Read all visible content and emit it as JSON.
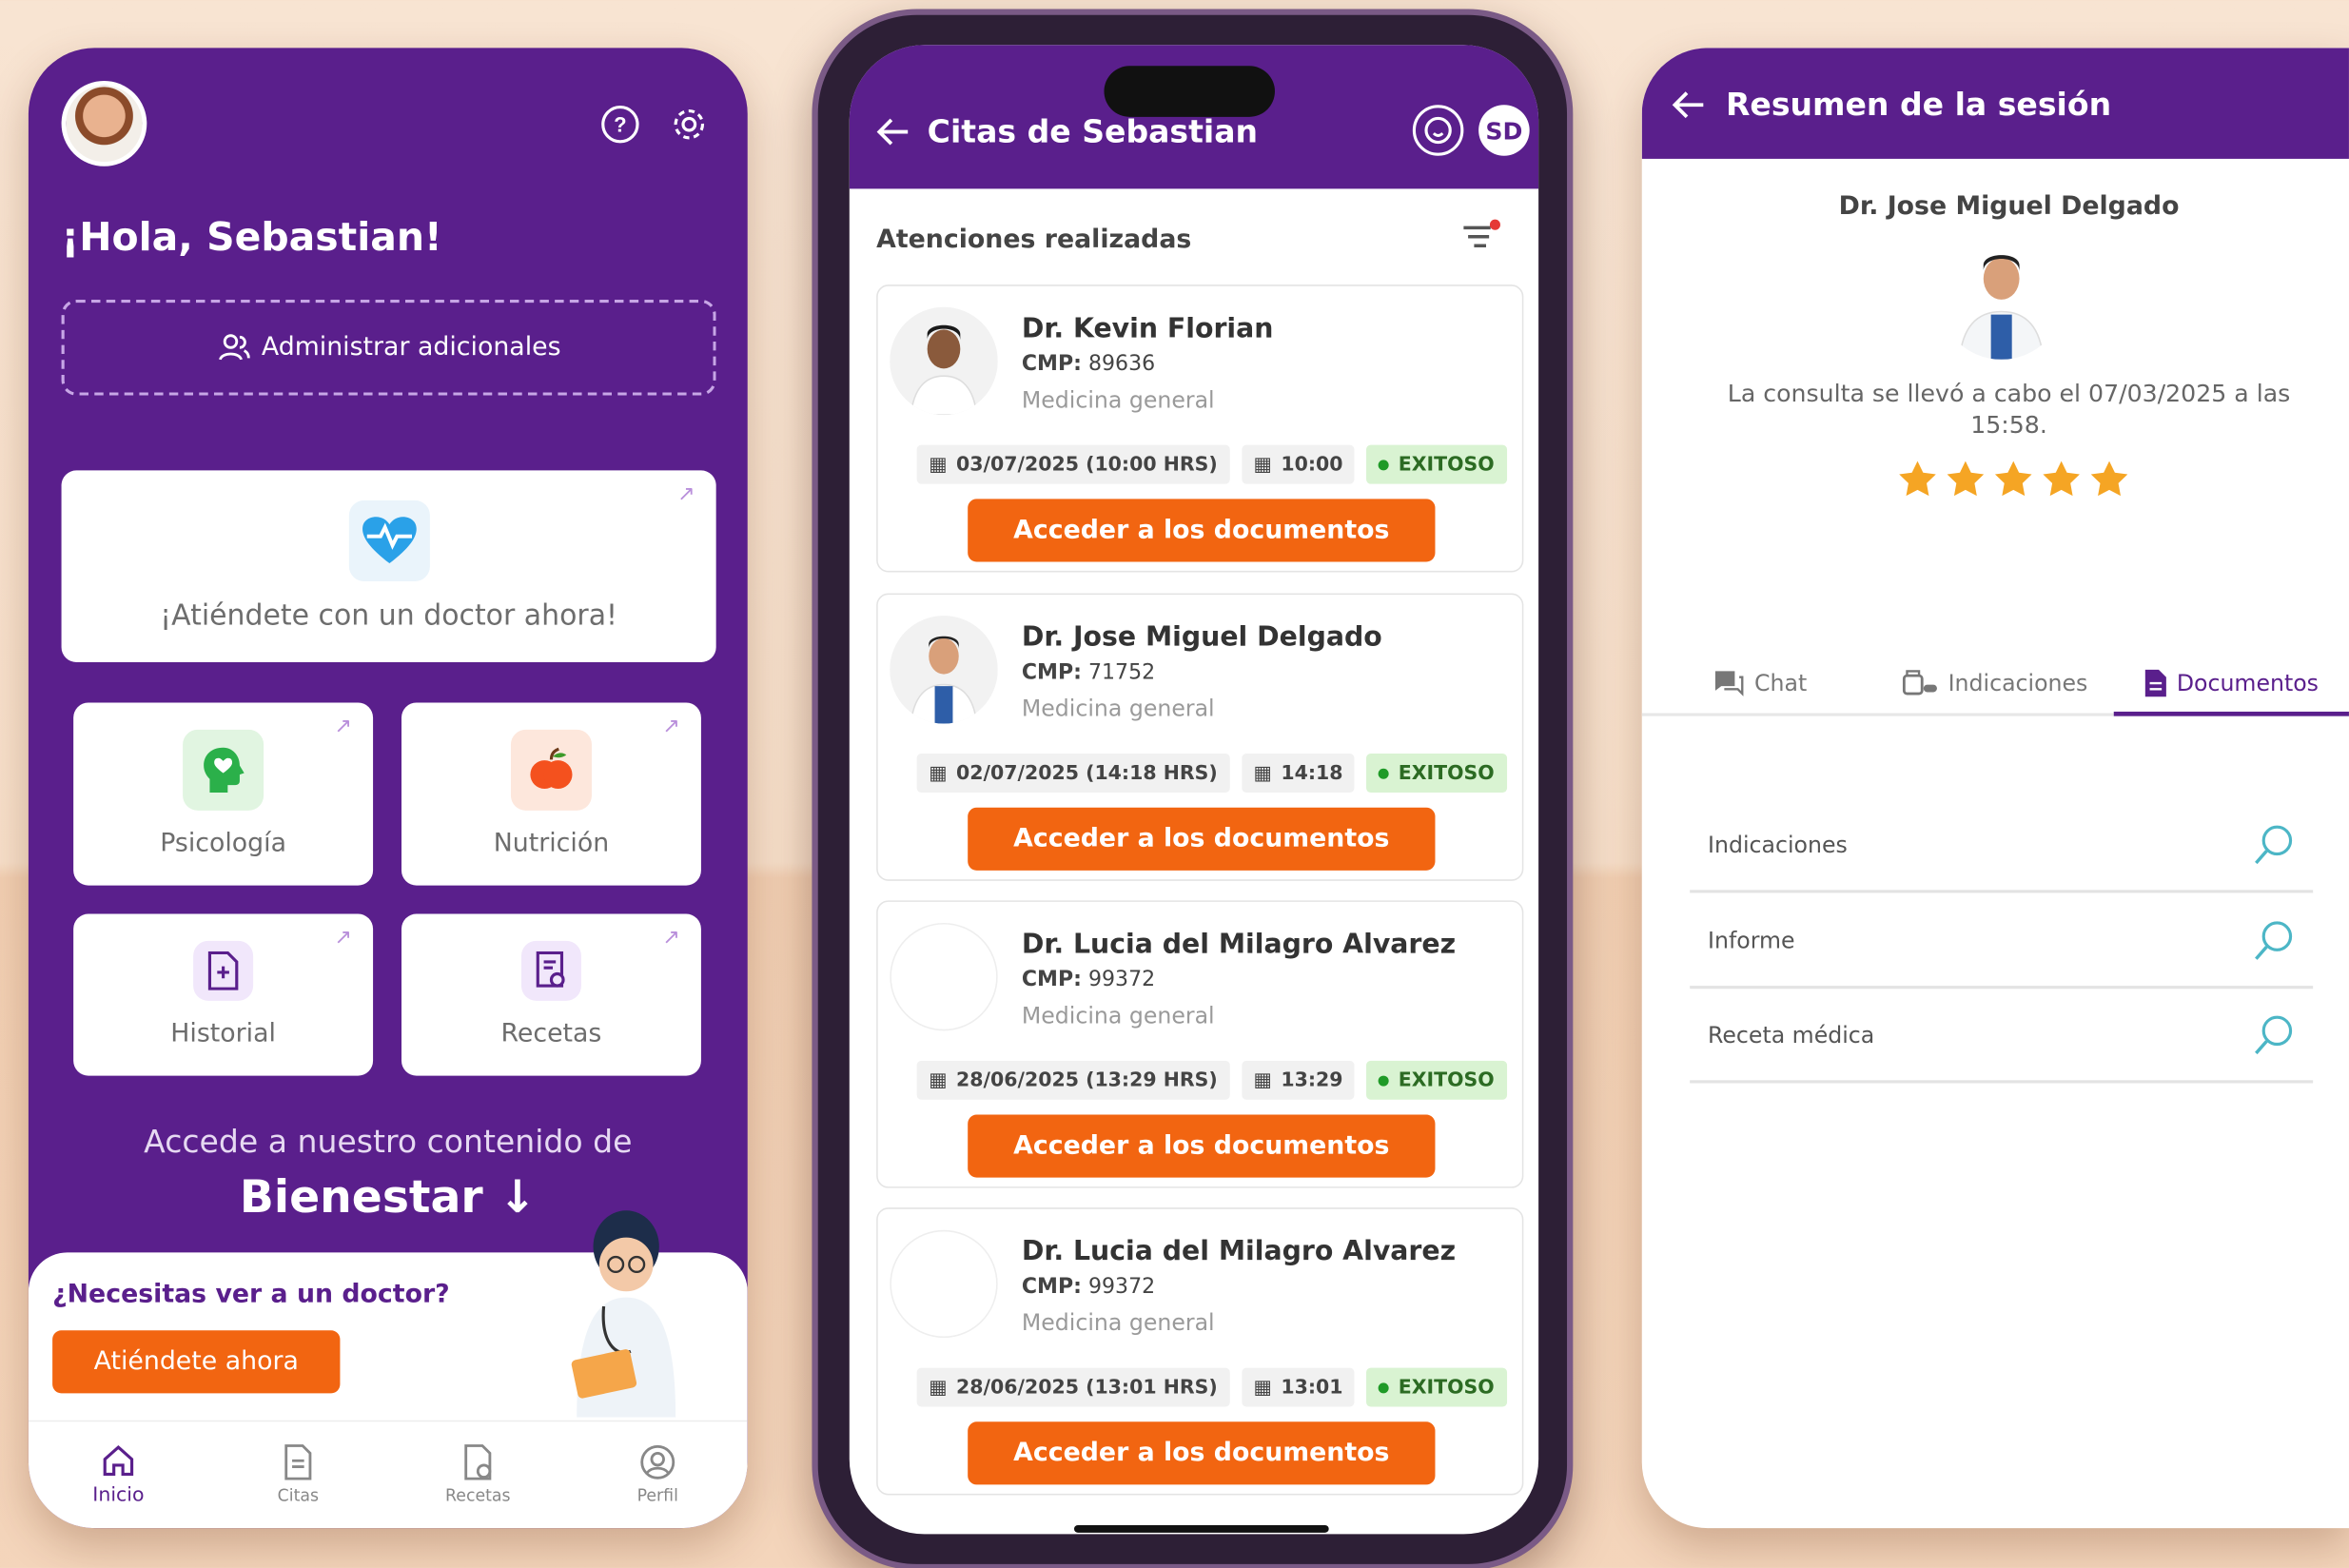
{
  "home": {
    "greeting": "¡Hola, Sebastian!",
    "admin_label": "Administrar adicionales",
    "urgent_card": "¡Atiéndete con un doctor ahora!",
    "services": [
      {
        "label": "Psicología"
      },
      {
        "label": "Nutrición"
      },
      {
        "label": "Historial"
      },
      {
        "label": "Recetas"
      }
    ],
    "wellness_line1": "Accede a nuestro contenido de",
    "wellness_line2": "Bienestar ↓",
    "need_doctor": "¿Necesitas ver a un doctor?",
    "attend_now": "Atiéndete ahora",
    "nav": [
      "Inicio",
      "Citas",
      "Recetas",
      "Perfil"
    ]
  },
  "appointments": {
    "title": "Citas de Sebastian",
    "user_initials": "SD",
    "subtitle": "Atenciones realizadas",
    "cmp_label": "CMP:",
    "button_label": "Acceder a los documentos",
    "items": [
      {
        "name": "Dr. Kevin Florian",
        "cmp": "89636",
        "spec": "Medicina general",
        "date": "03/07/2025 (10:00 HRS)",
        "time": "10:00",
        "status": "EXITOSO"
      },
      {
        "name": "Dr. Jose Miguel Delgado",
        "cmp": "71752",
        "spec": "Medicina general",
        "date": "02/07/2025 (14:18 HRS)",
        "time": "14:18",
        "status": "EXITOSO"
      },
      {
        "name": "Dr. Lucia del Milagro Alvarez",
        "cmp": "99372",
        "spec": "Medicina general",
        "date": "28/06/2025 (13:29 HRS)",
        "time": "13:29",
        "status": "EXITOSO"
      },
      {
        "name": "Dr. Lucia del Milagro Alvarez",
        "cmp": "99372",
        "spec": "Medicina general",
        "date": "28/06/2025 (13:01 HRS)",
        "time": "13:01",
        "status": "EXITOSO"
      }
    ]
  },
  "session": {
    "title": "Resumen de la sesión",
    "doctor": "Dr. Jose Miguel Delgado",
    "consult_text": "La consulta se llevó a cabo el 07/03/2025 a las 15:58.",
    "rating": 5,
    "tabs": [
      "Chat",
      "Indicaciones",
      "Documentos"
    ],
    "documents": [
      "Indicaciones",
      "Informe",
      "Receta médica"
    ]
  },
  "colors": {
    "primary": "#5a1f8c",
    "accent": "#f26511",
    "success": "#1f9a27"
  }
}
